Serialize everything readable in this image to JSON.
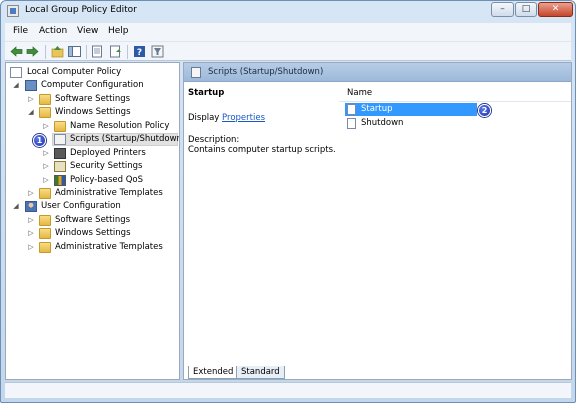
{
  "window": {
    "title": "Local Group Policy Editor",
    "controls": {
      "minimize": "–",
      "maximize": "□",
      "close": "✕"
    }
  },
  "menu": [
    "File",
    "Action",
    "View",
    "Help"
  ],
  "toolbar_icons": [
    "back-icon",
    "forward-icon",
    "up-icon",
    "show-hide-tree-icon",
    "export-list-icon",
    "properties-icon",
    "help-icon",
    "filter-icon"
  ],
  "tree": {
    "root": "Local Computer Policy",
    "computer_configuration": "Computer Configuration",
    "software_settings": "Software Settings",
    "windows_settings": "Windows Settings",
    "name_resolution_policy": "Name Resolution Policy",
    "scripts": "Scripts (Startup/Shutdown)",
    "deployed_printers": "Deployed Printers",
    "security_settings": "Security Settings",
    "policy_based_qos": "Policy-based QoS",
    "administrative_templates": "Administrative Templates",
    "user_configuration": "User Configuration",
    "user_software_settings": "Software Settings",
    "user_windows_settings": "Windows Settings",
    "user_administrative_templates": "Administrative Templates"
  },
  "badges": {
    "one": "1",
    "two": "2"
  },
  "details": {
    "header": "Scripts (Startup/Shutdown)",
    "title": "Startup",
    "display_prefix": "Display",
    "properties_link": "Properties",
    "description_label": "Description:",
    "description_text": "Contains computer startup scripts."
  },
  "list": {
    "column_name": "Name",
    "items": [
      "Startup",
      "Shutdown"
    ],
    "selected": "Startup"
  },
  "tabs": [
    "Extended",
    "Standard"
  ],
  "colors": {
    "selection": "#3399ff",
    "link": "#1a56c6",
    "header": "#9db9da"
  }
}
